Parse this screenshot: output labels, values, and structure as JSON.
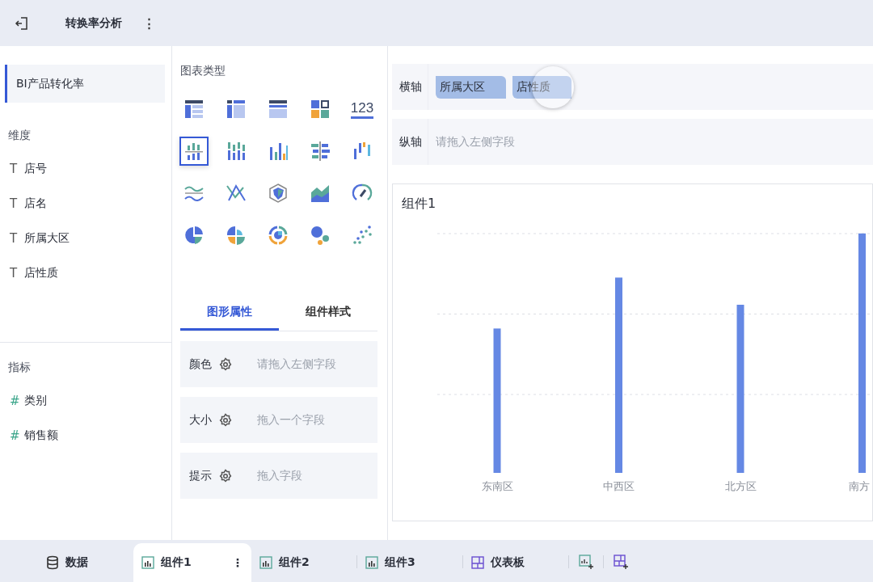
{
  "header": {
    "title": "转换率分析",
    "menu": "⋮"
  },
  "sidebar": {
    "dataset": {
      "label": "BI产品转化率",
      "selected": true
    },
    "dimensions": {
      "heading": "维度",
      "items": [
        {
          "type": "T",
          "label": "店号"
        },
        {
          "type": "T",
          "label": "店名"
        },
        {
          "type": "T",
          "label": "所属大区"
        },
        {
          "type": "T",
          "label": "店性质"
        }
      ]
    },
    "measures": {
      "heading": "指标",
      "items": [
        {
          "type": "#",
          "label": "类别"
        },
        {
          "type": "#",
          "label": "销售额"
        }
      ]
    }
  },
  "chart_types": {
    "heading": "图表类型",
    "items": [
      {
        "kind": "table",
        "selected": false
      },
      {
        "kind": "crosstab",
        "selected": false
      },
      {
        "kind": "detail",
        "selected": false
      },
      {
        "kind": "blocks",
        "selected": false
      },
      {
        "kind": "kpi",
        "label": "123",
        "selected": false
      },
      {
        "kind": "grouped",
        "selected": true
      },
      {
        "kind": "stacked",
        "selected": false
      },
      {
        "kind": "bars",
        "selected": false
      },
      {
        "kind": "hbars",
        "selected": false
      },
      {
        "kind": "waterfall",
        "selected": false
      },
      {
        "kind": "waves",
        "selected": false
      },
      {
        "kind": "cross",
        "selected": false
      },
      {
        "kind": "radar",
        "selected": false
      },
      {
        "kind": "area",
        "selected": false
      },
      {
        "kind": "gauge",
        "selected": false
      },
      {
        "kind": "pie",
        "selected": false
      },
      {
        "kind": "rose",
        "selected": false
      },
      {
        "kind": "sunburst",
        "selected": false
      },
      {
        "kind": "bubble",
        "selected": false
      },
      {
        "kind": "scatter",
        "selected": false
      }
    ]
  },
  "property_tabs": [
    {
      "label": "图形属性",
      "selected": true
    },
    {
      "label": "组件样式",
      "selected": false
    }
  ],
  "properties": [
    {
      "label": "颜色",
      "placeholder": "请拖入左侧字段"
    },
    {
      "label": "大小",
      "placeholder": "拖入一个字段"
    },
    {
      "label": "提示",
      "placeholder": "拖入字段"
    }
  ],
  "axes": [
    {
      "label": "横轴",
      "fields": [
        "所属大区",
        "店性质"
      ]
    },
    {
      "label": "纵轴",
      "placeholder": "请拖入左侧字段"
    }
  ],
  "widget": {
    "title": "组件1",
    "chart": {
      "categories": [
        "东南区",
        "中西区",
        "北方区",
        "南方"
      ]
    }
  },
  "bottom_tabs": [
    {
      "kind": "data",
      "label": "数据",
      "selected": false
    },
    {
      "kind": "widget",
      "label": "组件1",
      "menu": "⋮",
      "selected": true
    },
    {
      "kind": "widget",
      "label": "组件2",
      "selected": false
    },
    {
      "kind": "widget",
      "label": "组件3",
      "selected": false
    },
    {
      "kind": "dashboard",
      "label": "仪表板",
      "selected": false
    }
  ]
}
